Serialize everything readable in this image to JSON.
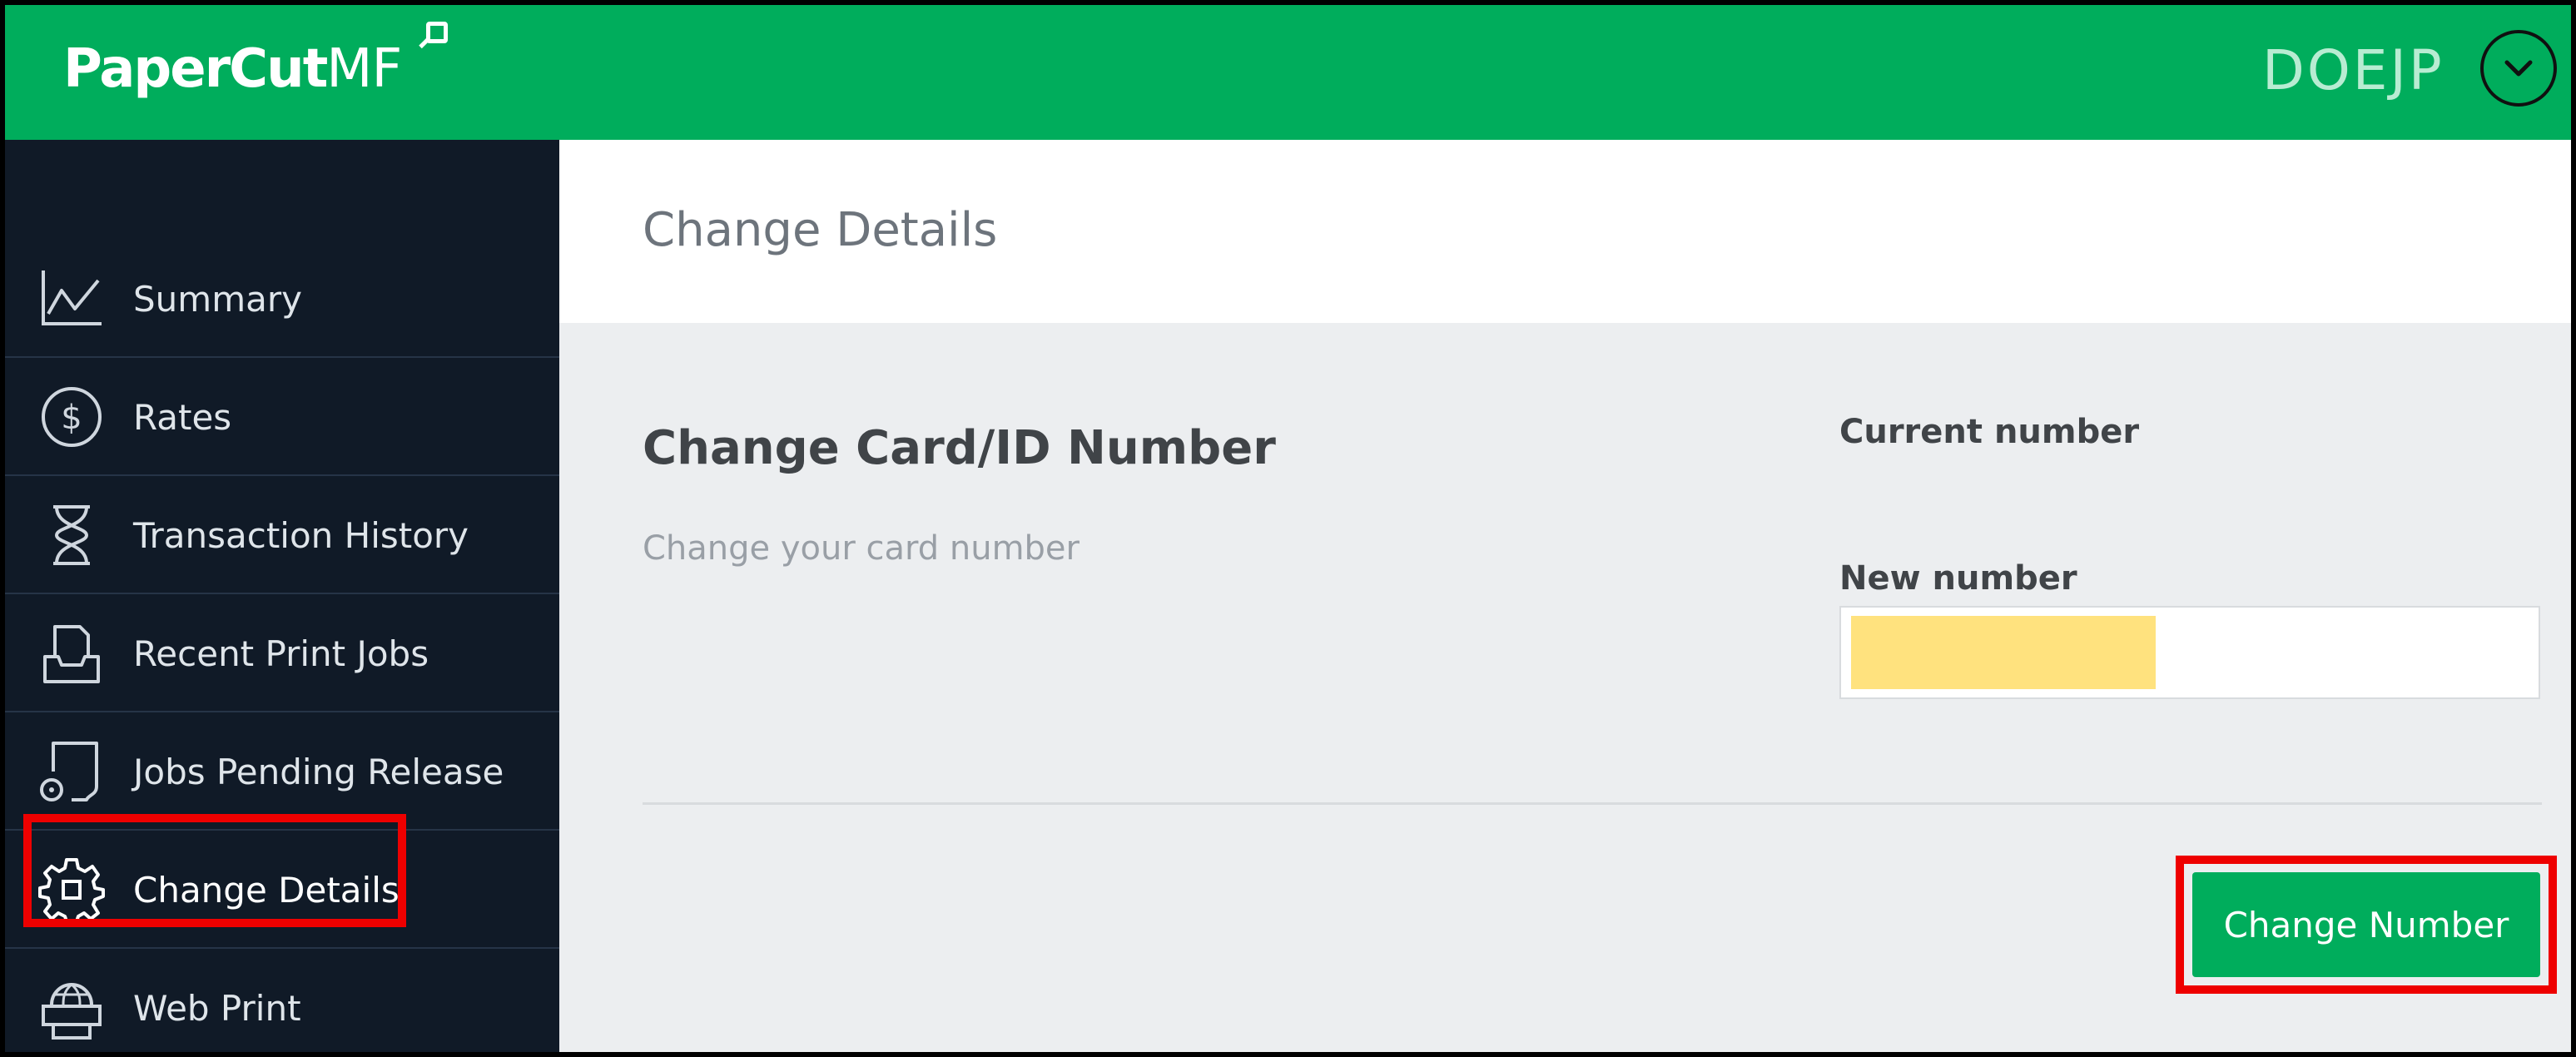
{
  "app": {
    "brand": "PaperCut",
    "brand_suffix": "MF",
    "user": "DOEJP",
    "accent_color": "#00ad5c",
    "highlight_color": "#ee0000"
  },
  "sidebar": {
    "items": [
      {
        "label": "Summary",
        "icon": "chart-line-icon"
      },
      {
        "label": "Rates",
        "icon": "dollar-circle-icon"
      },
      {
        "label": "Transaction History",
        "icon": "hourglass-icon"
      },
      {
        "label": "Recent Print Jobs",
        "icon": "print-tray-icon"
      },
      {
        "label": "Jobs Pending Release",
        "icon": "pending-document-icon"
      },
      {
        "label": "Change Details",
        "icon": "gear-icon",
        "active": true
      },
      {
        "label": "Web Print",
        "icon": "globe-printer-icon"
      }
    ]
  },
  "main": {
    "page_title": "Change Details",
    "section_title": "Change Card/ID Number",
    "section_subtitle": "Change your card number",
    "current_number_label": "Current number",
    "new_number_label": "New number",
    "new_number_value": "",
    "submit_label": "Change Number"
  }
}
